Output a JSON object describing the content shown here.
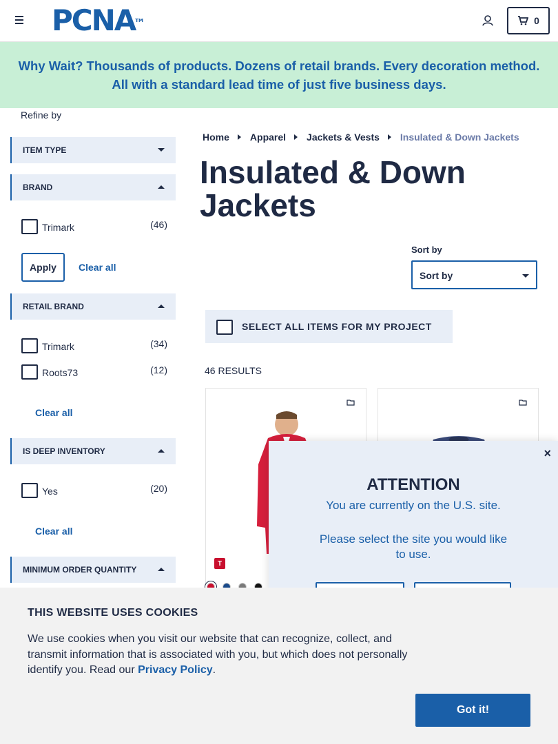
{
  "header": {
    "logo_text": "PCNA",
    "logo_tm": "TM",
    "cart_count": "0"
  },
  "banner": {
    "text": "Why Wait? Thousands of products. Dozens of retail brands. Every decoration method. All with a standard lead time of just five business days."
  },
  "sidebar": {
    "refine_label": "Refine by",
    "facets": {
      "item_type": "ITEM TYPE",
      "brand": "BRAND",
      "retail_brand": "RETAIL BRAND",
      "deep_inventory": "IS DEEP INVENTORY",
      "min_order": "MINIMUM ORDER QUANTITY"
    },
    "brand_options": [
      {
        "label": "Trimark",
        "count": "(46)"
      }
    ],
    "retail_brand_options": [
      {
        "label": "Trimark",
        "count": "(34)"
      },
      {
        "label": "Roots73",
        "count": "(12)"
      }
    ],
    "deep_inventory_options": [
      {
        "label": "Yes",
        "count": "(20)"
      }
    ],
    "apply_label": "Apply",
    "clear_all_label": "Clear all"
  },
  "breadcrumb": [
    "Home",
    "Apparel",
    "Jackets & Vests",
    "Insulated & Down Jackets"
  ],
  "page_title": "Insulated & Down Jackets",
  "sort": {
    "label": "Sort by",
    "value": "Sort by"
  },
  "select_all_label": "SELECT ALL ITEMS FOR MY PROJECT",
  "results_count": "46 RESULTS",
  "products": [
    {
      "brand_badge": "T",
      "jacket_color": "#d61f3c",
      "swatches": [
        "#c8102e",
        "#1a4a8a",
        "#7a7a7a",
        "#111111"
      ]
    },
    {
      "jacket_color": "#3a4a7a"
    }
  ],
  "modal": {
    "close": "×",
    "title": "ATTENTION",
    "line1": "You are currently on the U.S. site.",
    "line2": "Please select the site you would like to use."
  },
  "cookie": {
    "title": "THIS WEBSITE USES COOKIES",
    "text": "We use cookies when you visit our website that can recognize, collect, and transmit information that is associated with you, but which does not personally identify you. Read our",
    "link": "Privacy Policy",
    "period": ".",
    "button": "Got it!"
  },
  "colors": {
    "brand_blue": "#1a5fa8",
    "navy": "#1f2a44",
    "banner_green": "#c8efd6",
    "facet_bg": "#e8eef7"
  }
}
